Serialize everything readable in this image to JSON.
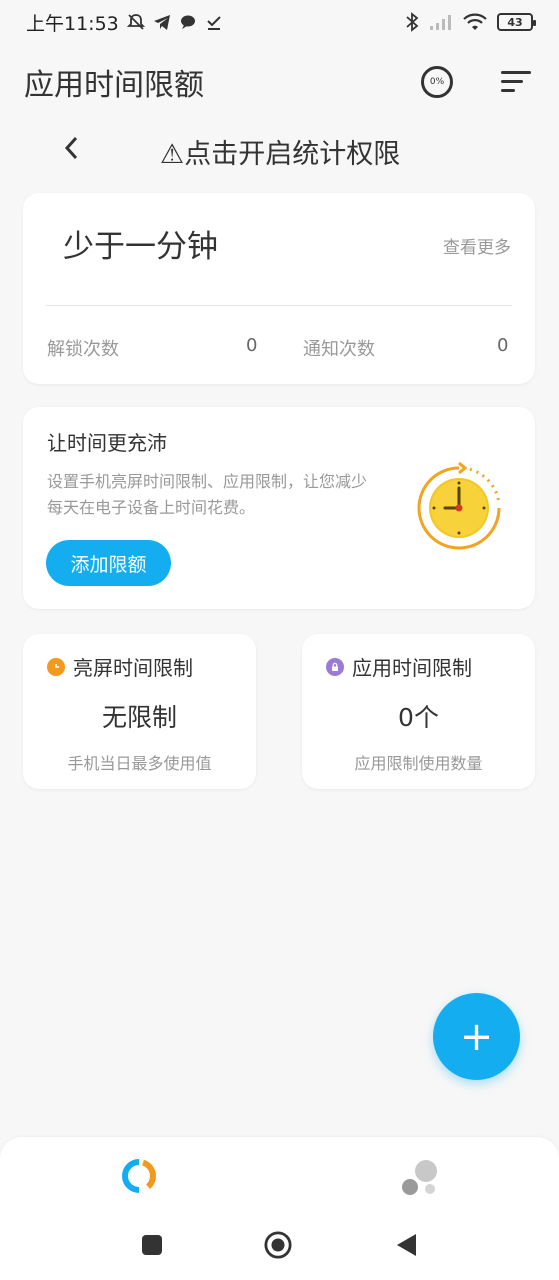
{
  "status_bar": {
    "time": "上午11:53",
    "battery_level": "43",
    "icons": [
      "notification-muted-icon",
      "telegram-icon",
      "chat-icon",
      "download-done-icon",
      "bluetooth-icon",
      "signal-icon",
      "wifi-icon",
      "battery-icon"
    ]
  },
  "header": {
    "title": "应用时间限额",
    "progress_label": "0%",
    "menu_icon": "sort-icon"
  },
  "date_nav": {
    "back_icon": "chevron-left-icon",
    "permission_text": "⚠点击开启统计权限"
  },
  "summary": {
    "usage_time": "少于一分钟",
    "see_more": "查看更多",
    "unlock_label": "解锁次数",
    "unlock_count": "0",
    "notify_label": "通知次数",
    "notify_count": "0"
  },
  "promo": {
    "title": "让时间更充沛",
    "description": "设置手机亮屏时间限制、应用限制，让您减少每天在电子设备上时间花费。",
    "button_label": "添加限额",
    "illustration": "clock-icon"
  },
  "limits": {
    "screen": {
      "title": "亮屏时间限制",
      "value": "无限制",
      "subtitle": "手机当日最多使用值",
      "icon_color": "#f39a1e"
    },
    "app": {
      "title": "应用时间限制",
      "value": "0个",
      "subtitle": "应用限制使用数量",
      "icon_color": "#9b7bd8"
    }
  },
  "fab": {
    "label": "+"
  },
  "bottom_tabs": [
    {
      "name": "usage-tab",
      "icon": "ring-chart-icon",
      "active": true
    },
    {
      "name": "apps-tab",
      "icon": "bubbles-icon",
      "active": false
    }
  ],
  "colors": {
    "accent": "#14aef0",
    "orange": "#f39a1e",
    "purple": "#9b7bd8"
  }
}
